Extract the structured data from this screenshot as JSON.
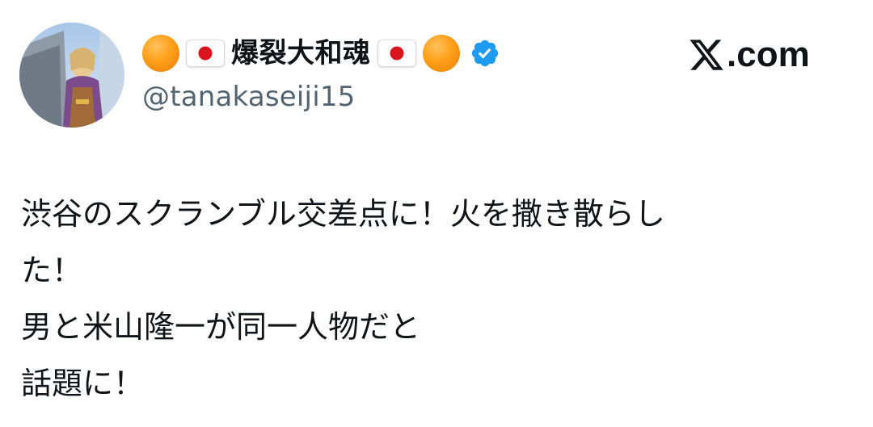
{
  "user": {
    "avatar_icon": "profile-avatar",
    "emoji_left": [
      "orange-circle-emoji",
      "japan-flag-emoji"
    ],
    "display_name": "爆裂大和魂",
    "emoji_right": [
      "japan-flag-emoji",
      "orange-circle-emoji"
    ],
    "verified_icon": "verified-badge-icon",
    "verified_color": "#1d9bf0",
    "handle": "@tanakaseiji15"
  },
  "brand": {
    "logo_icon": "x-logo-icon",
    "text": ".com"
  },
  "tweet": {
    "lines": [
      "渋谷のスクランブル交差点に！火を撒き散らし",
      "た！",
      "男と米山隆一が同一人物だと",
      "話題に！"
    ]
  },
  "colors": {
    "text_primary": "#0f1419",
    "text_secondary": "#536471",
    "orange_emoji": "#ff9f1a",
    "flag_red": "#d9141e"
  }
}
